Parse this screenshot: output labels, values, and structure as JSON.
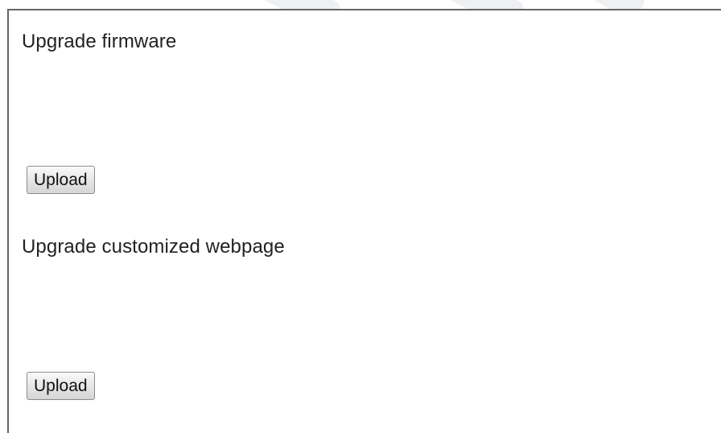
{
  "firmware_section": {
    "title": "Upgrade firmware",
    "upload_label": "Upload"
  },
  "webpage_section": {
    "title": "Upgrade customized webpage",
    "upload_label": "Upload"
  }
}
